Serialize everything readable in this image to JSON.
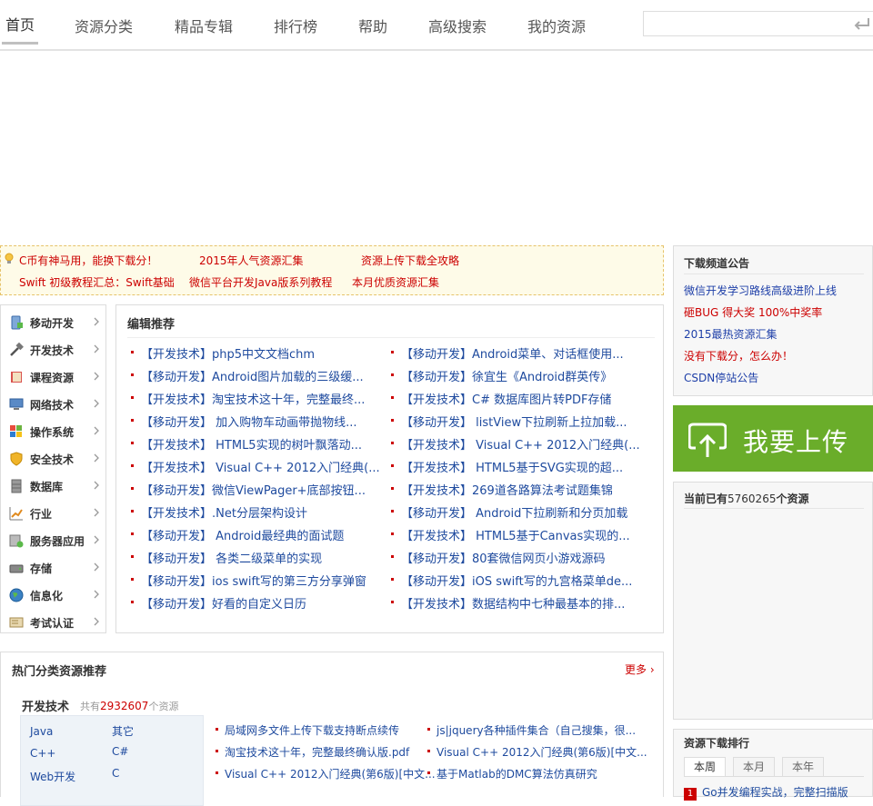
{
  "nav": {
    "tabs": [
      "首页",
      "资源分类",
      "精品专辑",
      "排行榜",
      "帮助",
      "高级搜索",
      "我的资源"
    ],
    "search_placeholder": ""
  },
  "notice": {
    "links": [
      "C币有神马用，能换下载分！",
      "2015年人气资源汇集",
      "资源上传下载全攻略",
      "Swift 初级教程汇总：Swift基础",
      "微信平台开发Java版系列教程",
      "本月优质资源汇集"
    ]
  },
  "categories": [
    "移动开发",
    "开发技术",
    "课程资源",
    "网络技术",
    "操作系统",
    "安全技术",
    "数据库",
    "行业",
    "服务器应用",
    "存储",
    "信息化",
    "考试认证"
  ],
  "editor": {
    "title": "编辑推荐",
    "left": [
      "【开发技术】php5中文文档chm",
      "【移动开发】Android图片加载的三级缓...",
      "【开发技术】淘宝技术这十年，完整最终...",
      "【移动开发】 加入购物车动画带抛物线...",
      "【开发技术】 HTML5实现的树叶飘落动...",
      "【开发技术】 Visual C++ 2012入门经典(...",
      "【移动开发】微信ViewPager+底部按钮...",
      "【开发技术】.Net分层架构设计",
      "【移动开发】 Android最经典的面试题",
      "【移动开发】 各类二级菜单的实现",
      "【移动开发】ios swift写的第三方分享弹窗",
      "【移动开发】好看的自定义日历"
    ],
    "right": [
      "【移动开发】Android菜单、对话框使用...",
      "【移动开发】徐宜生《Android群英传》",
      "【开发技术】C# 数据库图片转PDF存储",
      "【移动开发】 listView下拉刷新上拉加载...",
      "【开发技术】 Visual C++ 2012入门经典(...",
      "【开发技术】 HTML5基于SVG实现的超...",
      "【开发技术】269道各路算法考试题集锦",
      "【移动开发】 Android下拉刷新和分页加载",
      "【开发技术】 HTML5基于Canvas实现的...",
      "【移动开发】80套微信网页小游戏源码",
      "【移动开发】iOS swift写的九宫格菜单de...",
      "【开发技术】数据结构中七种最基本的排..."
    ]
  },
  "hot": {
    "title": "热门分类资源推荐",
    "more": "更多",
    "sub": "开发技术",
    "count_prefix": "共有",
    "count": "2932607",
    "count_suffix": "个资源",
    "cats": [
      "Java",
      "其它",
      "C++",
      "C#",
      "Web开发",
      "C"
    ],
    "col1": [
      "局域网多文件上传下载支持断点续传",
      "淘宝技术这十年，完整最终确认版.pdf",
      "Visual C++ 2012入门经典(第6版)[中文..."
    ],
    "col2": [
      "js|jquery各种插件集合（自己搜集，很...",
      "Visual C++ 2012入门经典(第6版)[中文...",
      "基于Matlab的DMC算法仿真研究"
    ]
  },
  "announce": {
    "title": "下载频道公告",
    "items": [
      {
        "text": "微信开发学习路线高级进阶上线",
        "color": "#1e3fa8"
      },
      {
        "text": "砸BUG 得大奖 100%中奖率",
        "color": "#cc0000"
      },
      {
        "text": "2015最热资源汇集",
        "color": "#1e3fa8"
      },
      {
        "text": "没有下载分，怎么办！",
        "color": "#cc0000"
      },
      {
        "text": "CSDN停站公告",
        "color": "#1e3fa8"
      }
    ]
  },
  "upload": {
    "label": "我要上传"
  },
  "resource_count": {
    "prefix": "当前已有",
    "value": "5760265",
    "suffix": "个资源"
  },
  "rank": {
    "title": "资源下载排行",
    "tabs": [
      "本周",
      "本月",
      "本年"
    ],
    "first": {
      "num": "1",
      "text": "Go并发编程实战，完整扫描版"
    }
  },
  "colors": {
    "accent_red": "#cc0000",
    "link_blue": "#1e4a9e",
    "upload_green": "#6aad2a"
  }
}
